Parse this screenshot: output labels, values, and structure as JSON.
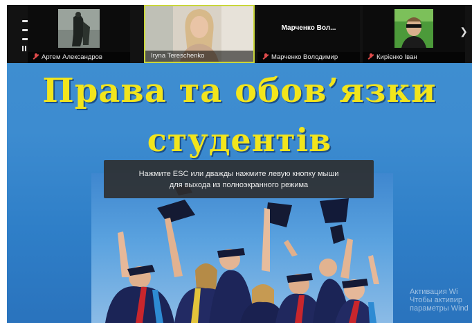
{
  "participants": [
    {
      "name": "Артем Александров",
      "muted": true
    },
    {
      "name": "Iryna Tereschenko",
      "muted": false
    },
    {
      "name": "Марченко Володимир",
      "muted": true,
      "display_title": "Марченко   Вол..."
    },
    {
      "name": "Кирієнко Іван",
      "muted": true
    }
  ],
  "slide": {
    "title_line1": "Права та обов’язки",
    "title_line2": "студентів"
  },
  "fullscreen_notice": {
    "line1": "Нажмите ESC или дважды нажмите левую кнопку мыши",
    "line2": "для выхода из полноэкранного режима"
  },
  "watermark": {
    "line1": "Активация Wi",
    "line2": "Чтобы активир",
    "line3": "параметры Wind"
  },
  "icons": {
    "next": "chevron-right-icon"
  }
}
